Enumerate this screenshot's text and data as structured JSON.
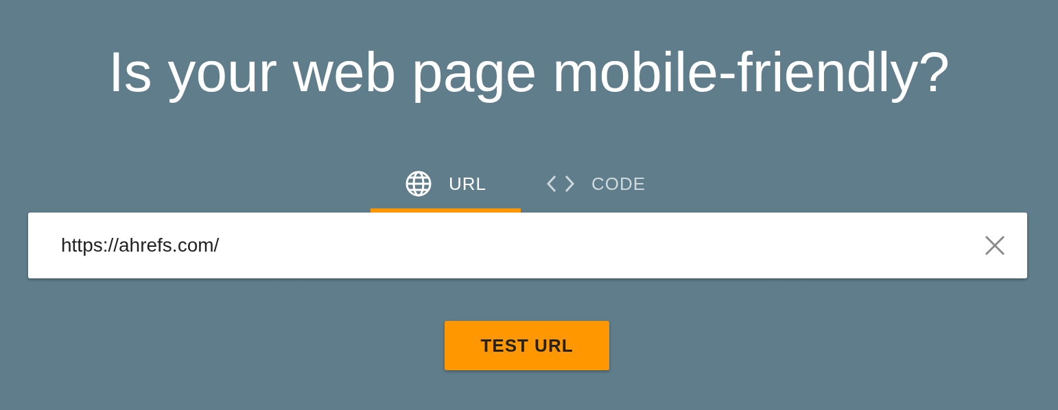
{
  "title": "Is your web page mobile-friendly?",
  "tabs": [
    {
      "label": "URL",
      "kind": "globe",
      "selected": true
    },
    {
      "label": "CODE",
      "kind": "code",
      "selected": false
    }
  ],
  "url_field": {
    "value": "https://ahrefs.com/"
  },
  "submit_button": {
    "label": "TEST URL"
  }
}
